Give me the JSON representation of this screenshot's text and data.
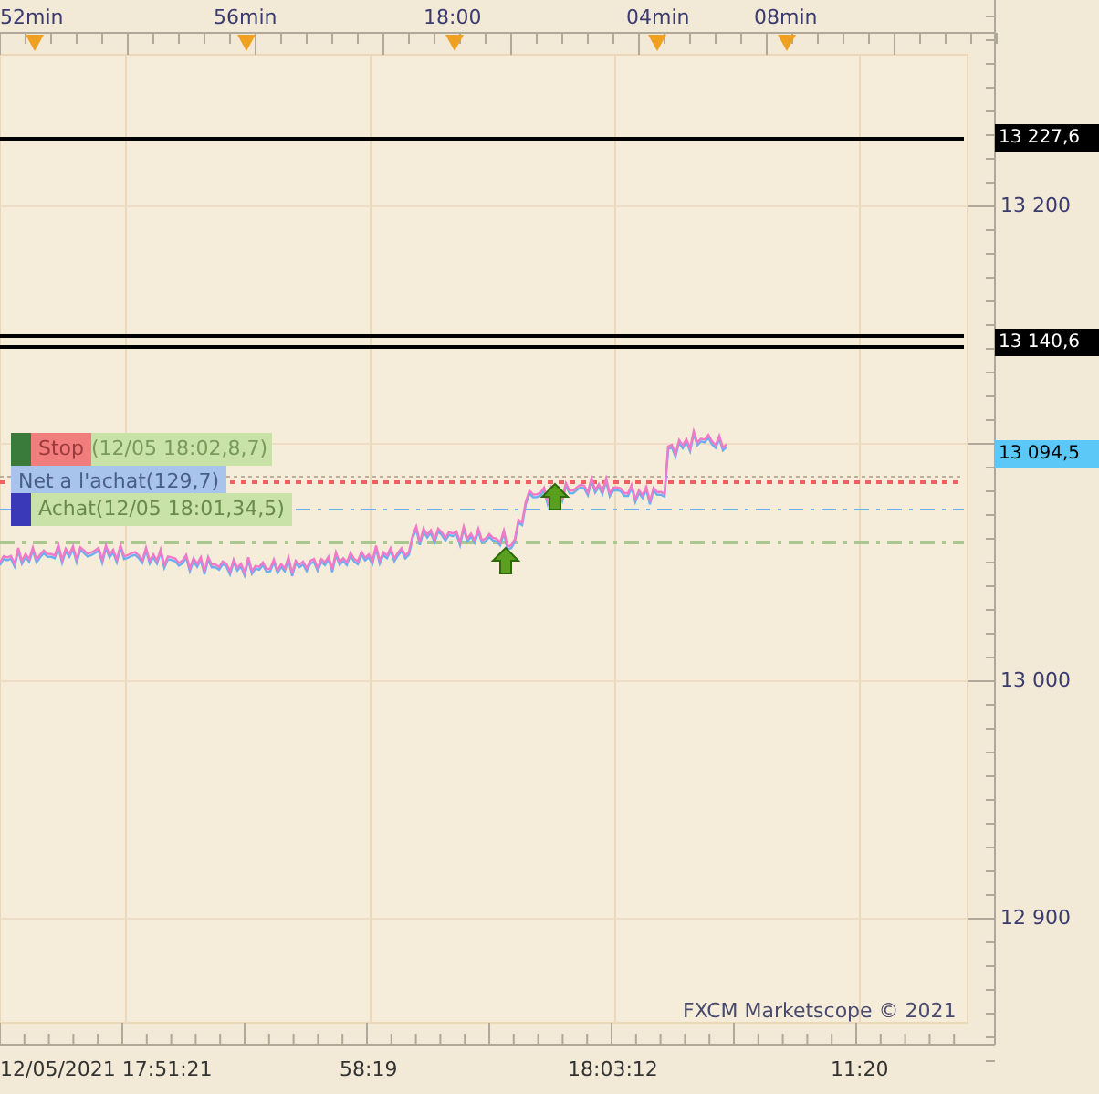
{
  "top_axis": {
    "labels": [
      "52min",
      "56min",
      "18:00",
      "04min",
      "08min"
    ]
  },
  "price_axis": {
    "labels": [
      "13 200",
      "13 000",
      "12 900"
    ]
  },
  "price_markers": [
    {
      "kind": "level",
      "text": "13 227,6"
    },
    {
      "kind": "level",
      "text": "13 140,6"
    },
    {
      "kind": "current",
      "text": "13 094,5"
    }
  ],
  "orders": [
    {
      "kind": "stop",
      "label": "Stop",
      "detail": "(12/05 18:02,8,7)",
      "color": "#3a7a3a"
    },
    {
      "kind": "net",
      "label": "Net a l'achat(129,7)"
    },
    {
      "kind": "buy",
      "label": "Achat(12/05 18:01,34,5)",
      "color": "#3a3ab8"
    }
  ],
  "copyright": "FXCM Marketscope © 2021",
  "bottom_axis": {
    "labels": [
      "12/05/2021 17:51:21",
      "58:19",
      "18:03:12",
      "11:20"
    ]
  }
}
